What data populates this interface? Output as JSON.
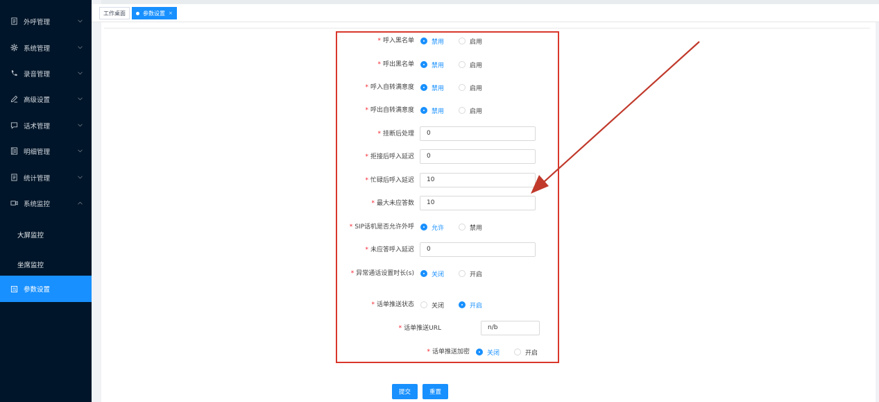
{
  "sidebar": {
    "items": [
      {
        "label": "外呼管理",
        "icon": "document-icon"
      },
      {
        "label": "系统管理",
        "icon": "gear-icon"
      },
      {
        "label": "录音管理",
        "icon": "phone-icon"
      },
      {
        "label": "高级设置",
        "icon": "pen-icon"
      },
      {
        "label": "话术管理",
        "icon": "chat-icon"
      },
      {
        "label": "明细管理",
        "icon": "list-icon"
      },
      {
        "label": "统计管理",
        "icon": "document-icon"
      },
      {
        "label": "系统监控",
        "icon": "video-icon"
      }
    ],
    "sub_items": [
      {
        "label": "大屏监控"
      },
      {
        "label": "坐席监控"
      }
    ],
    "active_item": {
      "label": "参数设置",
      "icon": "settings-doc-icon"
    }
  },
  "tabs": [
    {
      "label": "工作桌面",
      "active": false
    },
    {
      "label": "参数设置",
      "active": true,
      "close": "×"
    }
  ],
  "form": {
    "rows": [
      {
        "label": "呼入黑名单",
        "type": "radio",
        "options": [
          "禁用",
          "启用"
        ],
        "selected": "禁用"
      },
      {
        "label": "呼出黑名单",
        "type": "radio",
        "options": [
          "禁用",
          "启用"
        ],
        "selected": "禁用"
      },
      {
        "label": "呼入自转满意度",
        "type": "radio",
        "options": [
          "禁用",
          "启用"
        ],
        "selected": "禁用"
      },
      {
        "label": "呼出自转满意度",
        "type": "radio",
        "options": [
          "禁用",
          "启用"
        ],
        "selected": "禁用"
      },
      {
        "label": "挂断后处理",
        "type": "input",
        "value": "0"
      },
      {
        "label": "拒接后呼入延迟",
        "type": "input",
        "value": "0"
      },
      {
        "label": "忙碌后呼入延迟",
        "type": "input",
        "value": "10"
      },
      {
        "label": "最大未应答数",
        "type": "input",
        "value": "10"
      },
      {
        "label": "SIP话机是否允许外呼",
        "type": "radio",
        "options": [
          "允许",
          "禁用"
        ],
        "selected": "允许"
      },
      {
        "label": "未应答呼入延迟",
        "type": "input",
        "value": "0"
      },
      {
        "label": "异常通话设置时长(s)",
        "type": "radio",
        "options": [
          "关闭",
          "开启"
        ],
        "selected": "关闭"
      },
      {
        "label": "话单推送状态",
        "type": "radio",
        "options": [
          "关闭",
          "开启"
        ],
        "selected": "开启"
      },
      {
        "label": "话单推送URL",
        "type": "input",
        "value": "n/b"
      },
      {
        "label": "话单推送加密",
        "type": "radio",
        "options": [
          "关闭",
          "开启"
        ],
        "selected": "关闭"
      }
    ],
    "required_mark": "*"
  },
  "buttons": {
    "submit": "提交",
    "reset": "重置"
  },
  "colors": {
    "sidebar_bg": "#001529",
    "accent": "#1890ff",
    "annotation_red": "#d9362b"
  }
}
